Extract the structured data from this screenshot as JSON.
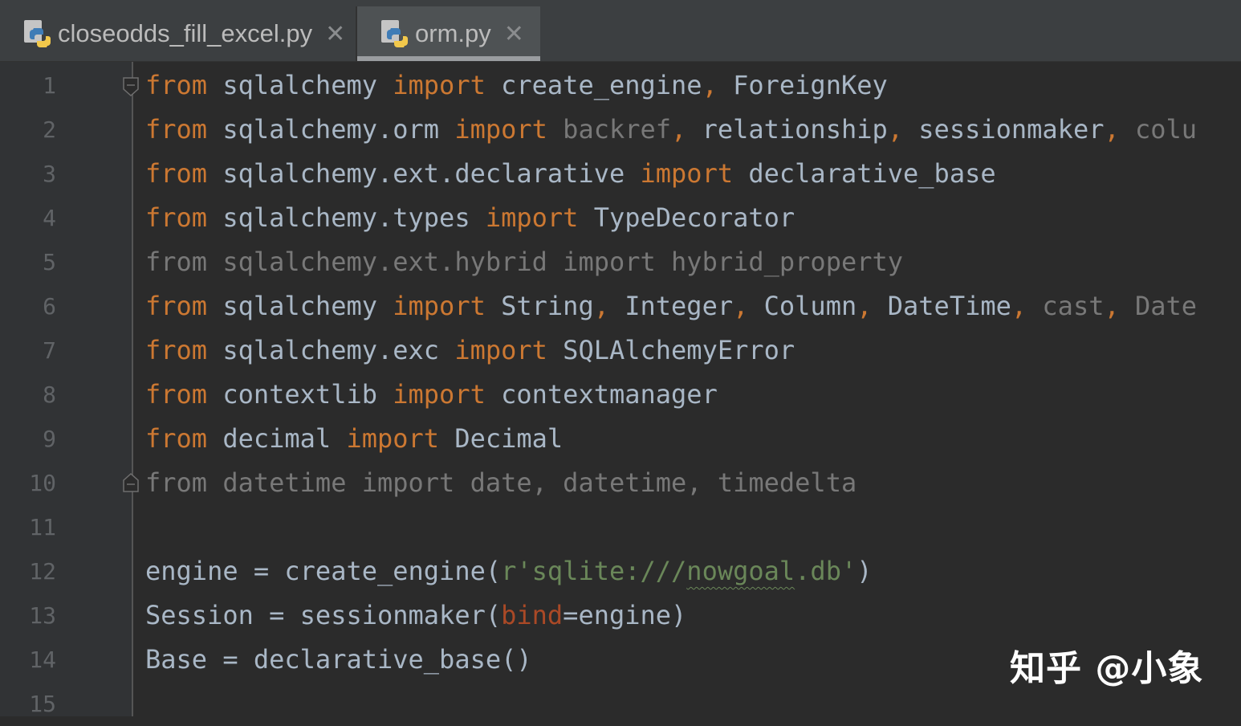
{
  "tabs": [
    {
      "label": "closeodds_fill_excel.py",
      "icon": "python-file-icon",
      "close": "✕",
      "active": false
    },
    {
      "label": "orm.py",
      "icon": "python-file-icon",
      "close": "✕",
      "active": true
    }
  ],
  "line_numbers": [
    "1",
    "2",
    "3",
    "4",
    "5",
    "6",
    "7",
    "8",
    "9",
    "10",
    "11",
    "12",
    "13",
    "14",
    "15"
  ],
  "code": {
    "l1": {
      "a": "from",
      "b": " sqlalchemy ",
      "c": "import",
      "d": " create_engine",
      "e": ",",
      "f": " ForeignKey"
    },
    "l2": {
      "a": "from",
      "b": " sqlalchemy.orm ",
      "c": "import",
      "d": " backref",
      "e": ",",
      "f": " relationship",
      "g": ",",
      "h": " sessionmaker",
      "i": ",",
      "j": " colu"
    },
    "l3": {
      "a": "from",
      "b": " sqlalchemy.ext.declarative ",
      "c": "import",
      "d": " declarative_base"
    },
    "l4": {
      "a": "from",
      "b": " sqlalchemy.types ",
      "c": "import",
      "d": " TypeDecorator"
    },
    "l5": {
      "a": "from sqlalchemy.ext.hybrid import hybrid_property"
    },
    "l6": {
      "a": "from",
      "b": " sqlalchemy ",
      "c": "import",
      "d": " String",
      "e": ",",
      "f": " Integer",
      "g": ",",
      "h": " Column",
      "i": ",",
      "j": " DateTime",
      "k": ",",
      "l": " cast",
      "m": ",",
      "n": " Date"
    },
    "l7": {
      "a": "from",
      "b": " sqlalchemy.exc ",
      "c": "import",
      "d": " SQLAlchemyError"
    },
    "l8": {
      "a": "from",
      "b": " contextlib ",
      "c": "import",
      "d": " contextmanager"
    },
    "l9": {
      "a": "from",
      "b": " decimal ",
      "c": "import",
      "d": " Decimal"
    },
    "l10": {
      "a": "from datetime import date, datetime, timedelta"
    },
    "l12": {
      "a": "engine = create_engine(",
      "b": "r'sqlite:///",
      "c": "nowgoal",
      "d": ".db'",
      "e": ")"
    },
    "l13": {
      "a": "Session = sessionmaker(",
      "b": "bind",
      "c": "=engine)"
    },
    "l14": {
      "a": "Base = declarative_base()"
    }
  },
  "watermark": "知乎 @小象",
  "colors": {
    "background": "#2b2b2b",
    "keyword": "#cc7832",
    "identifier": "#a9b7c6",
    "unused_import": "#787878",
    "string": "#6a8759",
    "named_param": "#aa4926",
    "line_number": "#606366"
  }
}
